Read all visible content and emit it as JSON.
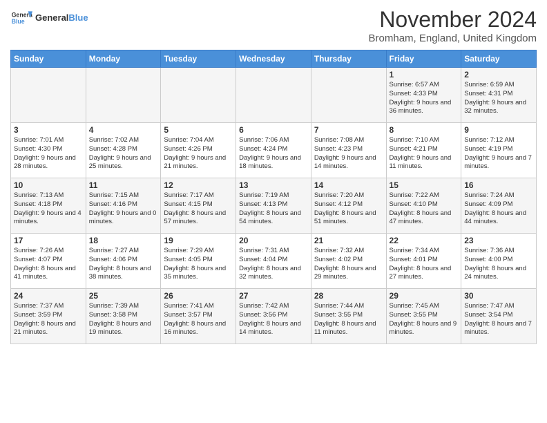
{
  "header": {
    "logo_general": "General",
    "logo_blue": "Blue",
    "month": "November 2024",
    "location": "Bromham, England, United Kingdom"
  },
  "days_of_week": [
    "Sunday",
    "Monday",
    "Tuesday",
    "Wednesday",
    "Thursday",
    "Friday",
    "Saturday"
  ],
  "weeks": [
    [
      {
        "day": "",
        "info": ""
      },
      {
        "day": "",
        "info": ""
      },
      {
        "day": "",
        "info": ""
      },
      {
        "day": "",
        "info": ""
      },
      {
        "day": "",
        "info": ""
      },
      {
        "day": "1",
        "info": "Sunrise: 6:57 AM\nSunset: 4:33 PM\nDaylight: 9 hours and 36 minutes."
      },
      {
        "day": "2",
        "info": "Sunrise: 6:59 AM\nSunset: 4:31 PM\nDaylight: 9 hours and 32 minutes."
      }
    ],
    [
      {
        "day": "3",
        "info": "Sunrise: 7:01 AM\nSunset: 4:30 PM\nDaylight: 9 hours and 28 minutes."
      },
      {
        "day": "4",
        "info": "Sunrise: 7:02 AM\nSunset: 4:28 PM\nDaylight: 9 hours and 25 minutes."
      },
      {
        "day": "5",
        "info": "Sunrise: 7:04 AM\nSunset: 4:26 PM\nDaylight: 9 hours and 21 minutes."
      },
      {
        "day": "6",
        "info": "Sunrise: 7:06 AM\nSunset: 4:24 PM\nDaylight: 9 hours and 18 minutes."
      },
      {
        "day": "7",
        "info": "Sunrise: 7:08 AM\nSunset: 4:23 PM\nDaylight: 9 hours and 14 minutes."
      },
      {
        "day": "8",
        "info": "Sunrise: 7:10 AM\nSunset: 4:21 PM\nDaylight: 9 hours and 11 minutes."
      },
      {
        "day": "9",
        "info": "Sunrise: 7:12 AM\nSunset: 4:19 PM\nDaylight: 9 hours and 7 minutes."
      }
    ],
    [
      {
        "day": "10",
        "info": "Sunrise: 7:13 AM\nSunset: 4:18 PM\nDaylight: 9 hours and 4 minutes."
      },
      {
        "day": "11",
        "info": "Sunrise: 7:15 AM\nSunset: 4:16 PM\nDaylight: 9 hours and 0 minutes."
      },
      {
        "day": "12",
        "info": "Sunrise: 7:17 AM\nSunset: 4:15 PM\nDaylight: 8 hours and 57 minutes."
      },
      {
        "day": "13",
        "info": "Sunrise: 7:19 AM\nSunset: 4:13 PM\nDaylight: 8 hours and 54 minutes."
      },
      {
        "day": "14",
        "info": "Sunrise: 7:20 AM\nSunset: 4:12 PM\nDaylight: 8 hours and 51 minutes."
      },
      {
        "day": "15",
        "info": "Sunrise: 7:22 AM\nSunset: 4:10 PM\nDaylight: 8 hours and 47 minutes."
      },
      {
        "day": "16",
        "info": "Sunrise: 7:24 AM\nSunset: 4:09 PM\nDaylight: 8 hours and 44 minutes."
      }
    ],
    [
      {
        "day": "17",
        "info": "Sunrise: 7:26 AM\nSunset: 4:07 PM\nDaylight: 8 hours and 41 minutes."
      },
      {
        "day": "18",
        "info": "Sunrise: 7:27 AM\nSunset: 4:06 PM\nDaylight: 8 hours and 38 minutes."
      },
      {
        "day": "19",
        "info": "Sunrise: 7:29 AM\nSunset: 4:05 PM\nDaylight: 8 hours and 35 minutes."
      },
      {
        "day": "20",
        "info": "Sunrise: 7:31 AM\nSunset: 4:04 PM\nDaylight: 8 hours and 32 minutes."
      },
      {
        "day": "21",
        "info": "Sunrise: 7:32 AM\nSunset: 4:02 PM\nDaylight: 8 hours and 29 minutes."
      },
      {
        "day": "22",
        "info": "Sunrise: 7:34 AM\nSunset: 4:01 PM\nDaylight: 8 hours and 27 minutes."
      },
      {
        "day": "23",
        "info": "Sunrise: 7:36 AM\nSunset: 4:00 PM\nDaylight: 8 hours and 24 minutes."
      }
    ],
    [
      {
        "day": "24",
        "info": "Sunrise: 7:37 AM\nSunset: 3:59 PM\nDaylight: 8 hours and 21 minutes."
      },
      {
        "day": "25",
        "info": "Sunrise: 7:39 AM\nSunset: 3:58 PM\nDaylight: 8 hours and 19 minutes."
      },
      {
        "day": "26",
        "info": "Sunrise: 7:41 AM\nSunset: 3:57 PM\nDaylight: 8 hours and 16 minutes."
      },
      {
        "day": "27",
        "info": "Sunrise: 7:42 AM\nSunset: 3:56 PM\nDaylight: 8 hours and 14 minutes."
      },
      {
        "day": "28",
        "info": "Sunrise: 7:44 AM\nSunset: 3:55 PM\nDaylight: 8 hours and 11 minutes."
      },
      {
        "day": "29",
        "info": "Sunrise: 7:45 AM\nSunset: 3:55 PM\nDaylight: 8 hours and 9 minutes."
      },
      {
        "day": "30",
        "info": "Sunrise: 7:47 AM\nSunset: 3:54 PM\nDaylight: 8 hours and 7 minutes."
      }
    ]
  ]
}
